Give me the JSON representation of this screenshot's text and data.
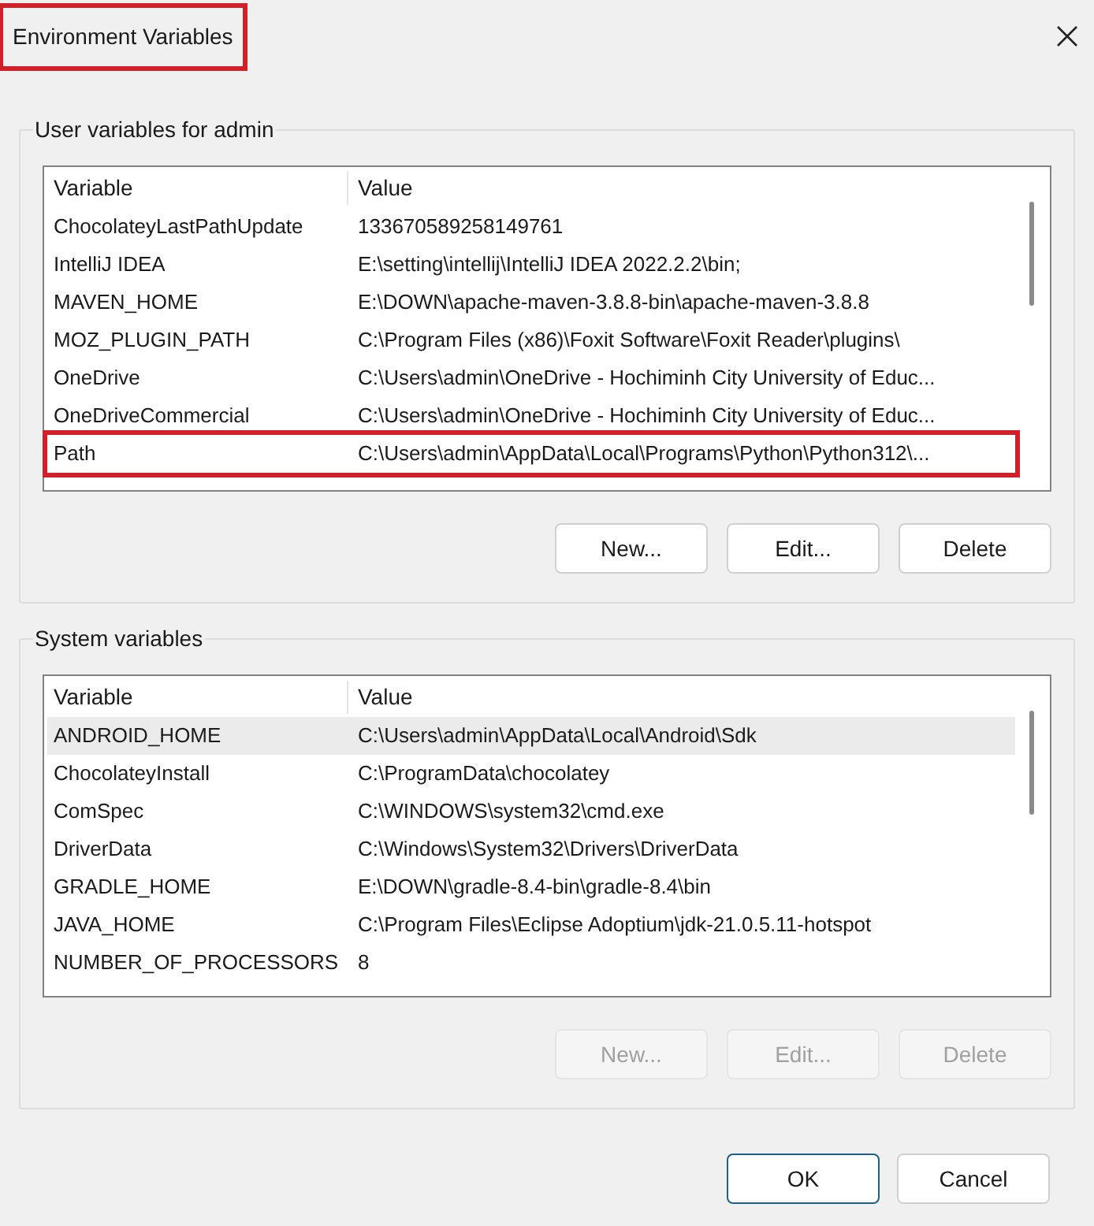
{
  "window": {
    "title": "Environment Variables",
    "title_highlighted": true
  },
  "user_variables": {
    "label": "User variables for admin",
    "columns": [
      "Variable",
      "Value"
    ],
    "rows": [
      {
        "variable": "ChocolateyLastPathUpdate",
        "value": "133670589258149761",
        "selected": false,
        "highlighted": false
      },
      {
        "variable": "IntelliJ IDEA",
        "value": "E:\\setting\\intellij\\IntelliJ IDEA 2022.2.2\\bin;",
        "selected": false,
        "highlighted": false
      },
      {
        "variable": "MAVEN_HOME",
        "value": "E:\\DOWN\\apache-maven-3.8.8-bin\\apache-maven-3.8.8",
        "selected": false,
        "highlighted": false
      },
      {
        "variable": "MOZ_PLUGIN_PATH",
        "value": "C:\\Program Files (x86)\\Foxit Software\\Foxit Reader\\plugins\\",
        "selected": false,
        "highlighted": false
      },
      {
        "variable": "OneDrive",
        "value": "C:\\Users\\admin\\OneDrive - Hochiminh City University of Educ...",
        "selected": false,
        "highlighted": false
      },
      {
        "variable": "OneDriveCommercial",
        "value": "C:\\Users\\admin\\OneDrive - Hochiminh City University of Educ...",
        "selected": false,
        "highlighted": false
      },
      {
        "variable": "Path",
        "value": "C:\\Users\\admin\\AppData\\Local\\Programs\\Python\\Python312\\...",
        "selected": false,
        "highlighted": true
      }
    ],
    "buttons": [
      {
        "label": "New...",
        "disabled": false
      },
      {
        "label": "Edit...",
        "disabled": false
      },
      {
        "label": "Delete",
        "disabled": false
      }
    ]
  },
  "system_variables": {
    "label": "System variables",
    "columns": [
      "Variable",
      "Value"
    ],
    "rows": [
      {
        "variable": "ANDROID_HOME",
        "value": "C:\\Users\\admin\\AppData\\Local\\Android\\Sdk",
        "selected": true,
        "highlighted": false
      },
      {
        "variable": "ChocolateyInstall",
        "value": "C:\\ProgramData\\chocolatey",
        "selected": false,
        "highlighted": false
      },
      {
        "variable": "ComSpec",
        "value": "C:\\WINDOWS\\system32\\cmd.exe",
        "selected": false,
        "highlighted": false
      },
      {
        "variable": "DriverData",
        "value": "C:\\Windows\\System32\\Drivers\\DriverData",
        "selected": false,
        "highlighted": false
      },
      {
        "variable": "GRADLE_HOME",
        "value": "E:\\DOWN\\gradle-8.4-bin\\gradle-8.4\\bin",
        "selected": false,
        "highlighted": false
      },
      {
        "variable": "JAVA_HOME",
        "value": "C:\\Program Files\\Eclipse Adoptium\\jdk-21.0.5.11-hotspot",
        "selected": false,
        "highlighted": false
      },
      {
        "variable": "NUMBER_OF_PROCESSORS",
        "value": "8",
        "selected": false,
        "highlighted": false
      }
    ],
    "buttons": [
      {
        "label": "New...",
        "disabled": true
      },
      {
        "label": "Edit...",
        "disabled": true
      },
      {
        "label": "Delete",
        "disabled": true
      }
    ]
  },
  "footer_buttons": [
    {
      "label": "OK",
      "default": true
    },
    {
      "label": "Cancel",
      "default": false
    }
  ]
}
